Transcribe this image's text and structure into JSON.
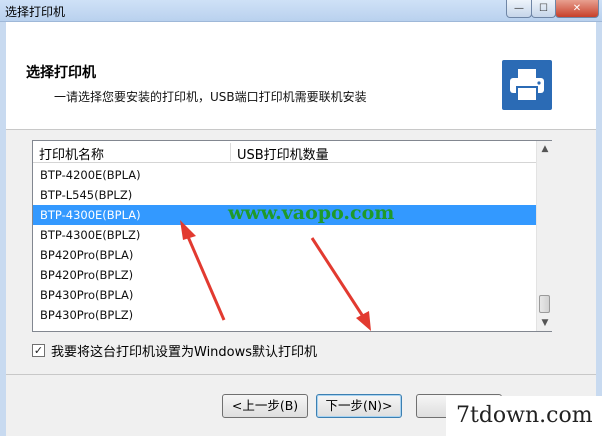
{
  "window": {
    "title": "选择打印机",
    "min_glyph": "—",
    "max_glyph": "☐",
    "close_glyph": "✕"
  },
  "header": {
    "title": "选择打印机",
    "subtitle": "一请选择您要安装的打印机，USB端口打印机需要联机安装",
    "icon": "printer-icon"
  },
  "list": {
    "columns": [
      "打印机名称",
      "USB打印机数量"
    ],
    "items": [
      "BTP-4200E(BPLA)",
      "BTP-L545(BPLZ)",
      "BTP-4300E(BPLA)",
      "BTP-4300E(BPLZ)",
      "BP420Pro(BPLA)",
      "BP420Pro(BPLZ)",
      "BP430Pro(BPLA)",
      "BP430Pro(BPLZ)"
    ],
    "selected_index": 2,
    "scroll_up_glyph": "▲",
    "scroll_down_glyph": "▼"
  },
  "checkbox": {
    "label": "我要将这台打印机设置为Windows默认打印机",
    "checked": true,
    "glyph": "✓"
  },
  "buttons": {
    "prev": "<上一步(B)",
    "next": "下一步(N)>",
    "cancel": "取消"
  },
  "watermarks": {
    "site": "www.vaopo.com",
    "brand": "7tdown.com"
  },
  "colors": {
    "selection": "#3399ff",
    "printer_icon_bg": "#2b6bb5",
    "arrow": "#e23a30",
    "watermark_green": "#1f9a2a"
  }
}
